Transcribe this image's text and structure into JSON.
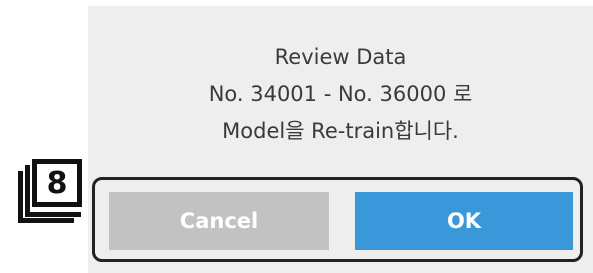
{
  "dialog": {
    "message_line1": "Review Data",
    "message_line2": "No. 34001 - No. 36000 로",
    "message_line3": "Model을 Re-train합니다.",
    "cancel_label": "Cancel",
    "ok_label": "OK"
  },
  "annotation": {
    "badge_number": "8"
  },
  "colors": {
    "dialog_background": "#eeeeee",
    "cancel_button": "#c2c2c2",
    "ok_button": "#3a97d9",
    "highlight_outline": "#222222"
  },
  "icons": {
    "badge": "stacked-number-badge-icon"
  }
}
